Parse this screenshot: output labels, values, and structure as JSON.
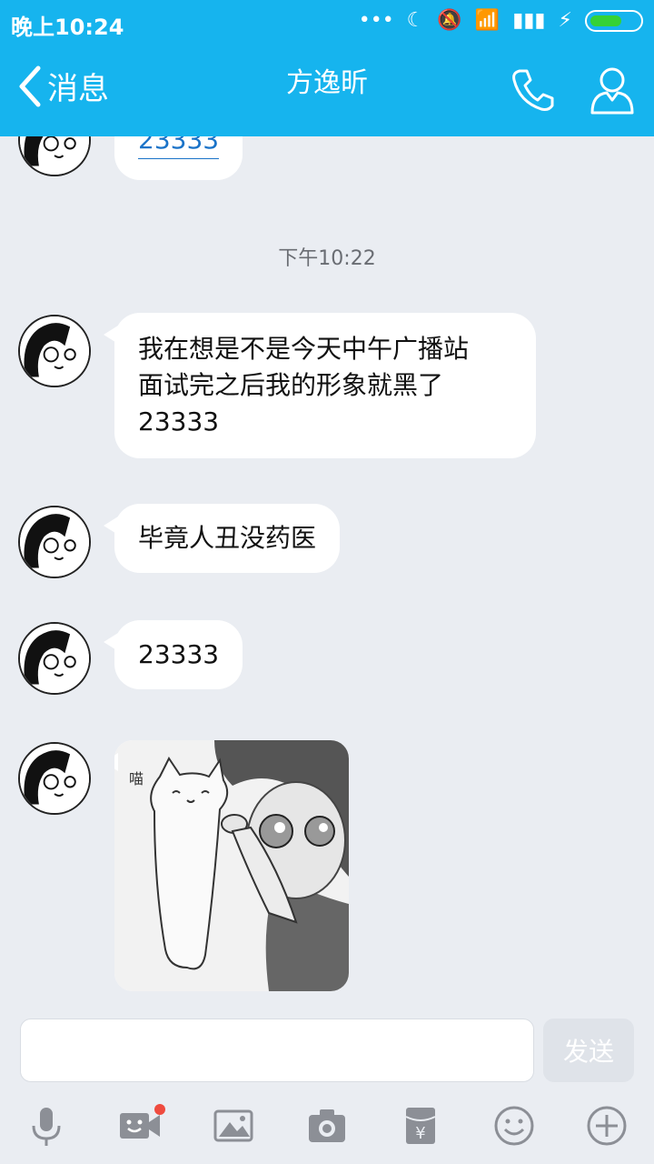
{
  "status_bar": {
    "time": "晚上10:24"
  },
  "nav": {
    "back_label": "消息",
    "title": "方逸昕"
  },
  "chat": {
    "partial_message": "23333",
    "timestamp": "下午10:22",
    "messages": [
      {
        "text_line1": "我在想是不是今天中午广播站",
        "text_line2": "面试完之后我的形象就黑了",
        "text_line3": "23333"
      },
      {
        "text": "毕竟人丑没药医"
      },
      {
        "text": "23333"
      }
    ]
  },
  "input": {
    "value": "",
    "placeholder": "",
    "send_label": "发送"
  },
  "toolbar": {
    "items": [
      "microphone-icon",
      "video-icon",
      "image-icon",
      "camera-icon",
      "red-packet-icon",
      "emoji-icon",
      "add-icon"
    ]
  },
  "colors": {
    "accent": "#16b4ee",
    "background": "#eaedf2",
    "notification_dot": "#ef4b3f"
  }
}
